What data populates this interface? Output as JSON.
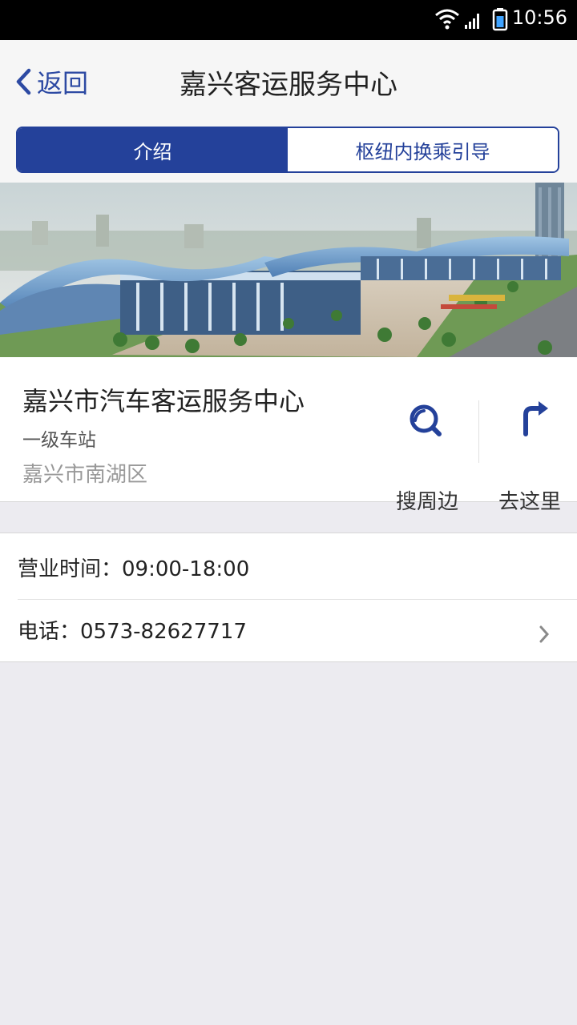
{
  "status_bar": {
    "time": "10:56",
    "icons": [
      "wifi-icon",
      "signal-icon",
      "battery-icon"
    ]
  },
  "nav": {
    "back_label": "返回",
    "title": "嘉兴客运服务中心"
  },
  "tabs": [
    {
      "label": "介绍",
      "active": true
    },
    {
      "label": "枢纽内换乘引导",
      "active": false
    }
  ],
  "station": {
    "name": "嘉兴市汽车客运服务中心",
    "level": "一级车站",
    "district": "嘉兴市南湖区"
  },
  "actions": {
    "search_around": "搜周边",
    "go_here": "去这里"
  },
  "details": {
    "hours": "营业时间：09:00-18:00",
    "phone": "电话：0573-82627717"
  },
  "colors": {
    "accent": "#24419a",
    "background": "#ecebf0",
    "nav_bg": "#f6f6f6"
  }
}
